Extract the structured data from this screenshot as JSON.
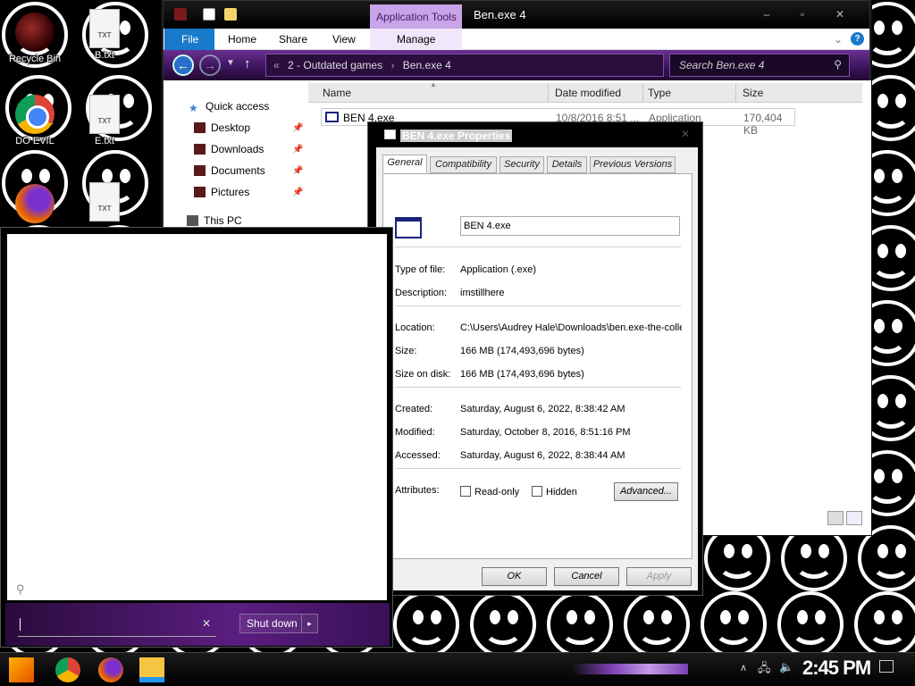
{
  "desktop": {
    "icons": [
      {
        "label": "Recycle Bin"
      },
      {
        "label": "B.txt"
      },
      {
        "label": "DO EVIL"
      },
      {
        "label": "E.txt"
      },
      {
        "label": "TXT"
      }
    ],
    "txt_badge": "TXT"
  },
  "explorer": {
    "context_tab": "Application Tools",
    "title": "Ben.exe 4",
    "ribbon_tabs": {
      "file": "File",
      "home": "Home",
      "share": "Share",
      "view": "View",
      "manage": "Manage"
    },
    "breadcrumb": {
      "root": "2 - Outdated games",
      "current": "Ben.exe 4"
    },
    "search_placeholder": "Search Ben.exe 4",
    "nav": {
      "quick_access": "Quick access",
      "desktop": "Desktop",
      "downloads": "Downloads",
      "documents": "Documents",
      "pictures": "Pictures",
      "this_pc": "This PC"
    },
    "columns": {
      "name": "Name",
      "date": "Date modified",
      "type": "Type",
      "size": "Size"
    },
    "file": {
      "name": "BEN 4.exe",
      "date": "10/8/2016 8:51 ...",
      "type": "Application",
      "size": "170,404 KB"
    }
  },
  "properties": {
    "title": "BEN 4.exe Properties",
    "tabs": {
      "general": "General",
      "compatibility": "Compatibility",
      "security": "Security",
      "details": "Details",
      "previous": "Previous Versions"
    },
    "file_name": "BEN 4.exe",
    "labels": {
      "type": "Type of file:",
      "description": "Description:",
      "location": "Location:",
      "size": "Size:",
      "size_on_disk": "Size on disk:",
      "created": "Created:",
      "modified": "Modified:",
      "accessed": "Accessed:",
      "attributes": "Attributes:"
    },
    "values": {
      "type": "Application (.exe)",
      "description": "imstillhere",
      "location": "C:\\Users\\Audrey Hale\\Downloads\\ben.exe-the-colle",
      "size": "166 MB (174,493,696 bytes)",
      "size_on_disk": "166 MB (174,493,696 bytes)",
      "created": "Saturday, August 6, 2022, 8:38:42 AM",
      "modified": "Saturday, October 8, 2016, 8:51:16 PM",
      "accessed": "Saturday, August 6, 2022, 8:38:44 AM"
    },
    "attributes": {
      "read_only": "Read-only",
      "hidden": "Hidden",
      "advanced": "Advanced..."
    },
    "buttons": {
      "ok": "OK",
      "cancel": "Cancel",
      "apply": "Apply"
    }
  },
  "start_menu": {
    "search_value": "",
    "shutdown_label": "Shut down"
  },
  "taskbar": {
    "clock": "2:45 PM"
  }
}
